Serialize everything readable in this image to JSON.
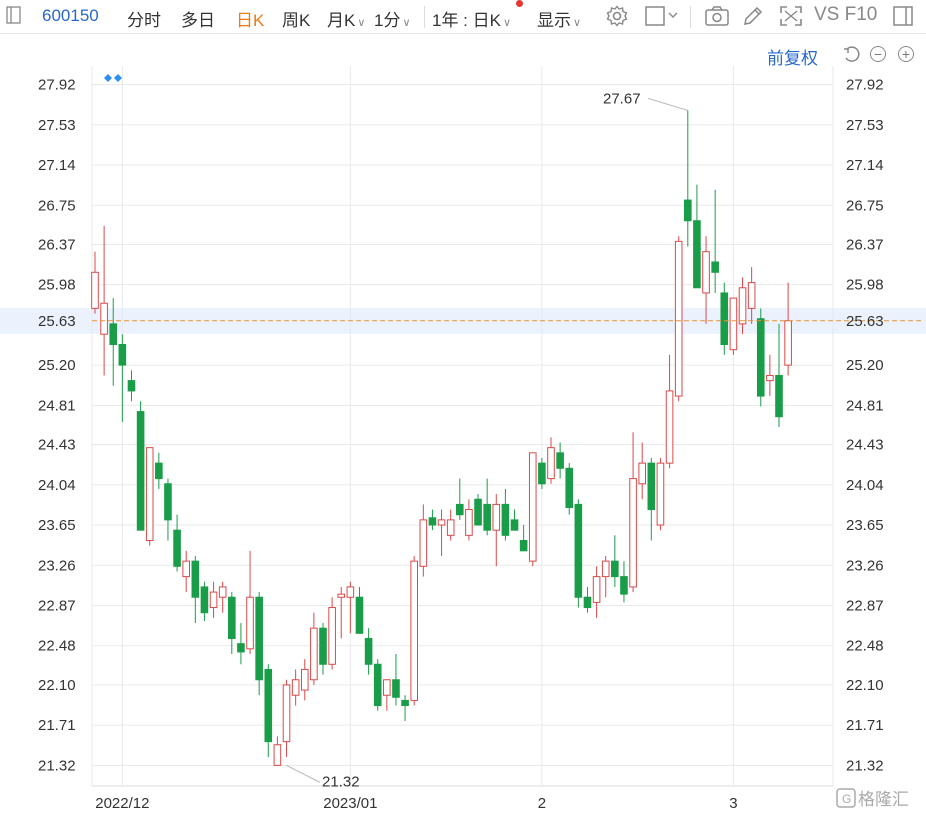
{
  "toolbar": {
    "code": "600150",
    "items": [
      "分时",
      "多日",
      "日K",
      "周K",
      "月K",
      "1分",
      "1年 : 日K",
      "显示"
    ],
    "active": "日K",
    "right_text": "VS F10"
  },
  "adjust_label": "前复权",
  "chart_data": {
    "type": "candlestick",
    "y_ticks": [
      "27.92",
      "27.53",
      "27.14",
      "26.75",
      "26.37",
      "25.98",
      "25.63",
      "25.20",
      "24.81",
      "24.43",
      "24.04",
      "23.65",
      "23.26",
      "22.87",
      "22.48",
      "22.10",
      "21.71",
      "21.32"
    ],
    "ylim": [
      21.12,
      28.1
    ],
    "x_tick_labels": [
      "2022/12",
      "2023/01",
      "2",
      "3"
    ],
    "x_tick_index": [
      3,
      28,
      49,
      70
    ],
    "current_price": "25.63",
    "high_annotation": "27.67",
    "low_annotation": "21.32",
    "high_index": 65,
    "low_index": 21,
    "candles": [
      {
        "o": 25.75,
        "h": 26.3,
        "l": 25.7,
        "c": 26.1
      },
      {
        "o": 25.5,
        "h": 26.55,
        "l": 25.1,
        "c": 25.8
      },
      {
        "o": 25.6,
        "h": 25.85,
        "l": 25.0,
        "c": 25.4
      },
      {
        "o": 25.4,
        "h": 25.5,
        "l": 24.65,
        "c": 25.2
      },
      {
        "o": 25.05,
        "h": 25.15,
        "l": 24.85,
        "c": 24.95
      },
      {
        "o": 24.75,
        "h": 24.85,
        "l": 23.6,
        "c": 23.6
      },
      {
        "o": 23.5,
        "h": 24.4,
        "l": 23.45,
        "c": 24.4
      },
      {
        "o": 24.25,
        "h": 24.35,
        "l": 24.0,
        "c": 24.1
      },
      {
        "o": 24.05,
        "h": 24.1,
        "l": 23.5,
        "c": 23.7
      },
      {
        "o": 23.6,
        "h": 23.75,
        "l": 23.2,
        "c": 23.25
      },
      {
        "o": 23.15,
        "h": 23.4,
        "l": 23.0,
        "c": 23.3
      },
      {
        "o": 23.3,
        "h": 23.35,
        "l": 22.7,
        "c": 22.95
      },
      {
        "o": 23.05,
        "h": 23.1,
        "l": 22.72,
        "c": 22.8
      },
      {
        "o": 22.85,
        "h": 23.1,
        "l": 22.75,
        "c": 23.0
      },
      {
        "o": 22.95,
        "h": 23.1,
        "l": 22.8,
        "c": 23.05
      },
      {
        "o": 22.95,
        "h": 23.0,
        "l": 22.4,
        "c": 22.55
      },
      {
        "o": 22.5,
        "h": 22.7,
        "l": 22.3,
        "c": 22.42
      },
      {
        "o": 22.45,
        "h": 23.4,
        "l": 22.4,
        "c": 22.95
      },
      {
        "o": 22.95,
        "h": 23.0,
        "l": 22.0,
        "c": 22.15
      },
      {
        "o": 22.25,
        "h": 22.3,
        "l": 21.4,
        "c": 21.55
      },
      {
        "o": 21.32,
        "h": 21.6,
        "l": 21.32,
        "c": 21.52
      },
      {
        "o": 21.55,
        "h": 22.15,
        "l": 21.4,
        "c": 22.1
      },
      {
        "o": 22.0,
        "h": 22.25,
        "l": 21.9,
        "c": 22.15
      },
      {
        "o": 22.05,
        "h": 22.35,
        "l": 21.95,
        "c": 22.25
      },
      {
        "o": 22.15,
        "h": 22.8,
        "l": 22.1,
        "c": 22.65
      },
      {
        "o": 22.65,
        "h": 22.7,
        "l": 22.2,
        "c": 22.3
      },
      {
        "o": 22.3,
        "h": 22.95,
        "l": 22.25,
        "c": 22.85
      },
      {
        "o": 22.95,
        "h": 23.05,
        "l": 22.55,
        "c": 22.98
      },
      {
        "o": 22.95,
        "h": 23.1,
        "l": 22.6,
        "c": 23.05
      },
      {
        "o": 22.95,
        "h": 23.05,
        "l": 22.6,
        "c": 22.6
      },
      {
        "o": 22.55,
        "h": 22.65,
        "l": 22.2,
        "c": 22.3
      },
      {
        "o": 22.3,
        "h": 22.35,
        "l": 21.85,
        "c": 21.9
      },
      {
        "o": 22.0,
        "h": 22.1,
        "l": 21.85,
        "c": 22.15
      },
      {
        "o": 22.15,
        "h": 22.4,
        "l": 21.9,
        "c": 21.98
      },
      {
        "o": 21.95,
        "h": 22.0,
        "l": 21.75,
        "c": 21.9
      },
      {
        "o": 21.95,
        "h": 23.35,
        "l": 21.9,
        "c": 23.3
      },
      {
        "o": 23.25,
        "h": 23.85,
        "l": 23.15,
        "c": 23.7
      },
      {
        "o": 23.72,
        "h": 23.8,
        "l": 23.6,
        "c": 23.65
      },
      {
        "o": 23.65,
        "h": 23.8,
        "l": 23.35,
        "c": 23.7
      },
      {
        "o": 23.55,
        "h": 23.8,
        "l": 23.5,
        "c": 23.7
      },
      {
        "o": 23.85,
        "h": 24.1,
        "l": 23.7,
        "c": 23.75
      },
      {
        "o": 23.55,
        "h": 23.9,
        "l": 23.5,
        "c": 23.8
      },
      {
        "o": 23.9,
        "h": 23.95,
        "l": 23.65,
        "c": 23.65
      },
      {
        "o": 23.85,
        "h": 24.1,
        "l": 23.55,
        "c": 23.6
      },
      {
        "o": 23.6,
        "h": 23.95,
        "l": 23.25,
        "c": 23.85
      },
      {
        "o": 23.85,
        "h": 24.0,
        "l": 23.5,
        "c": 23.55
      },
      {
        "o": 23.7,
        "h": 23.8,
        "l": 23.6,
        "c": 23.6
      },
      {
        "o": 23.5,
        "h": 23.65,
        "l": 23.4,
        "c": 23.4
      },
      {
        "o": 23.3,
        "h": 24.35,
        "l": 23.25,
        "c": 24.35
      },
      {
        "o": 24.25,
        "h": 24.3,
        "l": 24.0,
        "c": 24.05
      },
      {
        "o": 24.1,
        "h": 24.5,
        "l": 24.05,
        "c": 24.4
      },
      {
        "o": 24.35,
        "h": 24.45,
        "l": 24.1,
        "c": 24.2
      },
      {
        "o": 24.2,
        "h": 24.25,
        "l": 23.75,
        "c": 23.82
      },
      {
        "o": 23.85,
        "h": 23.9,
        "l": 22.85,
        "c": 22.95
      },
      {
        "o": 22.95,
        "h": 23.05,
        "l": 22.8,
        "c": 22.85
      },
      {
        "o": 22.9,
        "h": 23.25,
        "l": 22.75,
        "c": 23.15
      },
      {
        "o": 23.15,
        "h": 23.35,
        "l": 22.95,
        "c": 23.3
      },
      {
        "o": 23.3,
        "h": 23.55,
        "l": 23.05,
        "c": 23.15
      },
      {
        "o": 23.15,
        "h": 23.3,
        "l": 22.9,
        "c": 22.98
      },
      {
        "o": 23.05,
        "h": 24.55,
        "l": 23.0,
        "c": 24.1
      },
      {
        "o": 24.05,
        "h": 24.45,
        "l": 23.9,
        "c": 24.25
      },
      {
        "o": 24.25,
        "h": 24.3,
        "l": 23.5,
        "c": 23.8
      },
      {
        "o": 23.65,
        "h": 24.3,
        "l": 23.6,
        "c": 24.25
      },
      {
        "o": 24.25,
        "h": 25.3,
        "l": 24.2,
        "c": 24.95
      },
      {
        "o": 24.9,
        "h": 26.45,
        "l": 24.85,
        "c": 26.4
      },
      {
        "o": 26.8,
        "h": 27.67,
        "l": 26.35,
        "c": 26.6
      },
      {
        "o": 26.6,
        "h": 26.95,
        "l": 25.95,
        "c": 25.95
      },
      {
        "o": 25.9,
        "h": 26.45,
        "l": 25.6,
        "c": 26.3
      },
      {
        "o": 26.2,
        "h": 26.9,
        "l": 25.9,
        "c": 26.1
      },
      {
        "o": 25.9,
        "h": 26.0,
        "l": 25.3,
        "c": 25.4
      },
      {
        "o": 25.35,
        "h": 25.85,
        "l": 25.3,
        "c": 25.85
      },
      {
        "o": 25.6,
        "h": 26.05,
        "l": 25.5,
        "c": 25.95
      },
      {
        "o": 25.75,
        "h": 26.15,
        "l": 25.6,
        "c": 26.0
      },
      {
        "o": 25.65,
        "h": 25.75,
        "l": 24.8,
        "c": 24.9
      },
      {
        "o": 25.05,
        "h": 25.3,
        "l": 24.9,
        "c": 25.1
      },
      {
        "o": 25.1,
        "h": 25.6,
        "l": 24.6,
        "c": 24.7
      },
      {
        "o": 25.2,
        "h": 26.0,
        "l": 25.1,
        "c": 25.63
      }
    ]
  },
  "colors": {
    "up": "#d94a4a",
    "down": "#1a9d49",
    "grid": "#eaeaea",
    "price_line": "#e8923a",
    "price_label": "#e8362f",
    "price_band": "#dbe7fb",
    "accent": "#2868c8"
  },
  "watermark": "格隆汇"
}
